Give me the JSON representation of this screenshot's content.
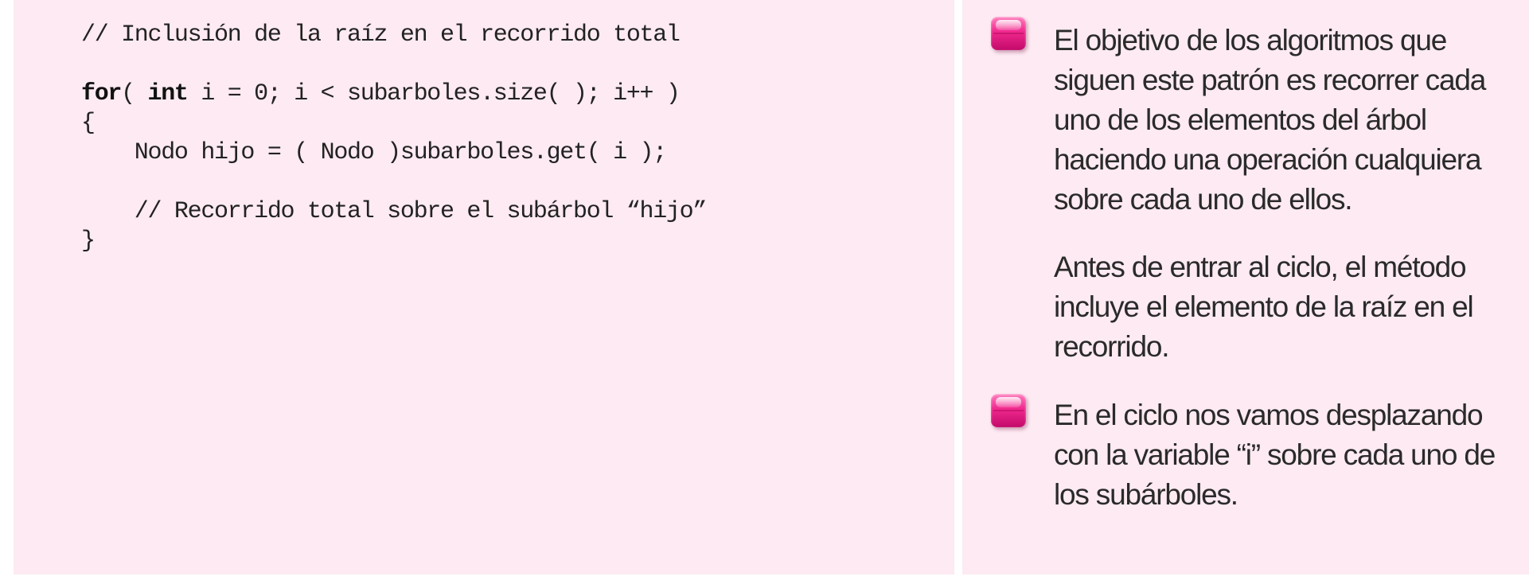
{
  "code": {
    "lines": [
      {
        "kind": "text",
        "text": "// Inclusión de la raíz en el recorrido total"
      },
      {
        "kind": "gap"
      },
      {
        "kind": "for",
        "kw1": "for",
        "mid": "( ",
        "kw2": "int",
        "rest": " i = 0; i < subarboles.size( ); i++ )"
      },
      {
        "kind": "text",
        "text": "{"
      },
      {
        "kind": "text",
        "text": "    Nodo hijo = ( Nodo )subarboles.get( i );"
      },
      {
        "kind": "gap"
      },
      {
        "kind": "text",
        "text": "    // Recorrido total sobre el subárbol “hijo”"
      },
      {
        "kind": "text",
        "text": "}"
      }
    ]
  },
  "notes": {
    "bullet_color": "#f0288e",
    "panel_color": "#fdeaf2",
    "items": [
      {
        "text": "El objetivo de los algoritmos que siguen este patrón es recorrer cada uno de los elementos del árbol haciendo una operación cualquiera sobre cada uno de ellos."
      },
      {
        "text": "Antes de entrar al ciclo, el método incluye el elemento de la raíz en el recorrido."
      },
      {
        "text": "En el ciclo nos vamos desplazando con la variable “i” sobre cada uno de los subárboles."
      }
    ]
  }
}
